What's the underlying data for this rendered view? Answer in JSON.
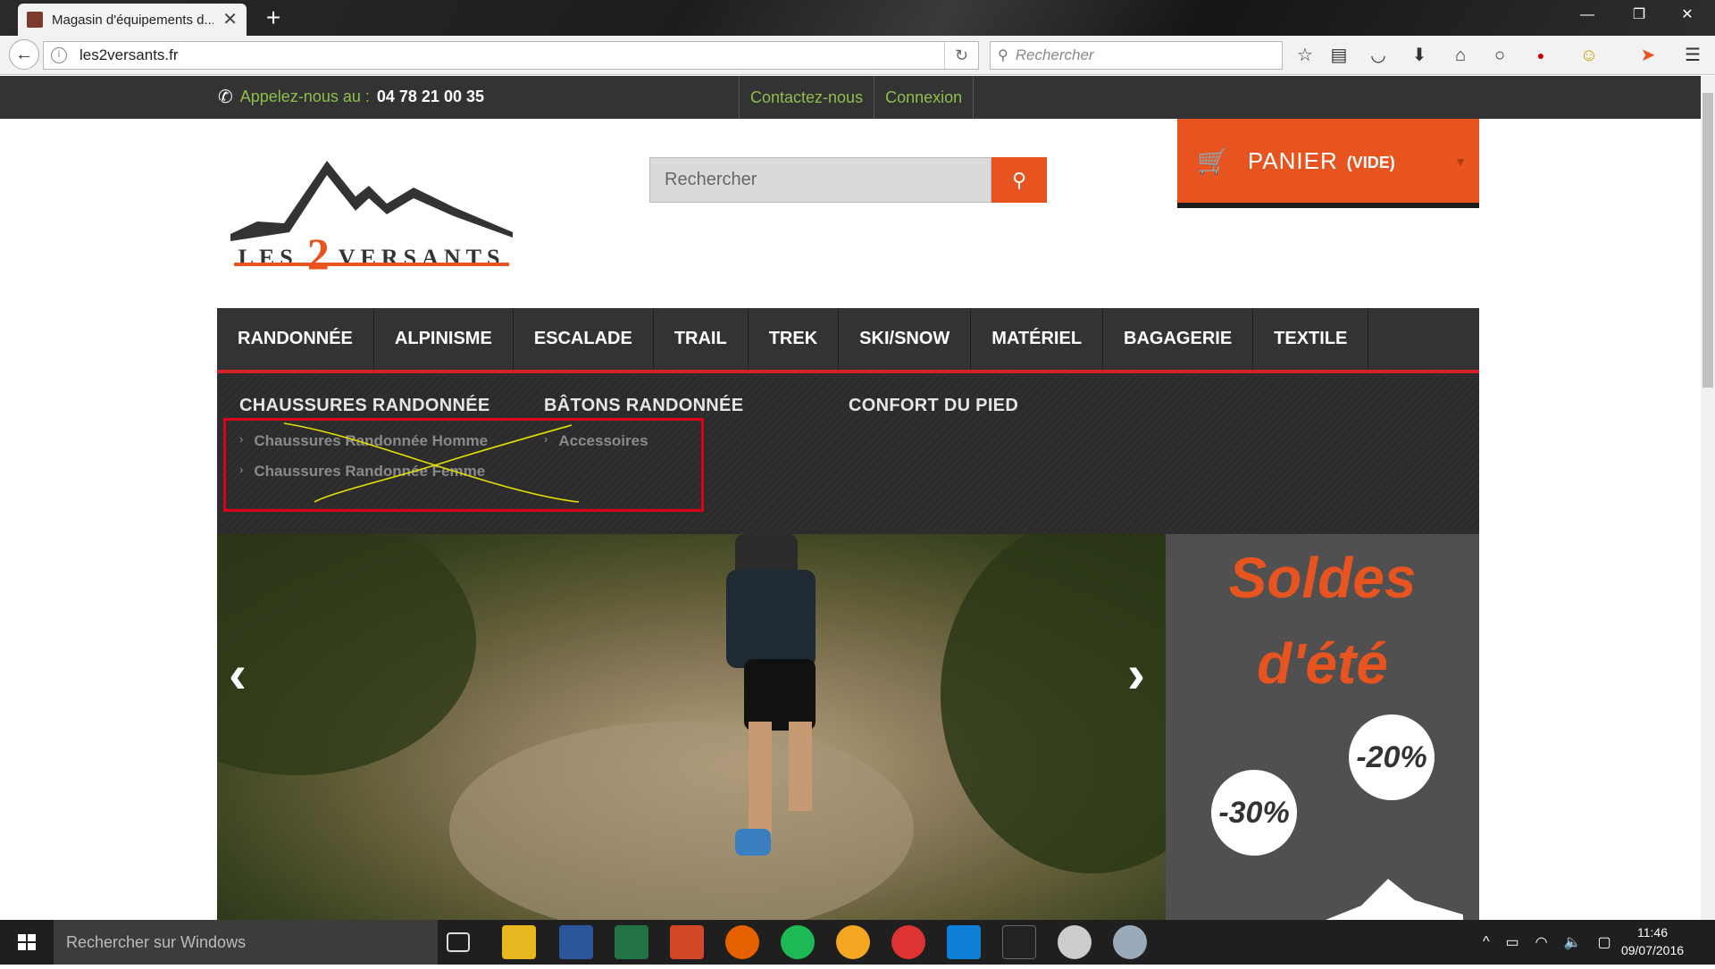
{
  "browser": {
    "tab_title": "Magasin d'équipements d...",
    "url": "les2versants.fr",
    "search_placeholder": "Rechercher"
  },
  "site": {
    "phone_label": "Appelez-nous au :",
    "phone_number": "04 78 21 00 35",
    "contact_link": "Contactez-nous",
    "login_link": "Connexion",
    "logo_text_left": "LES",
    "logo_number": "2",
    "logo_text_right": "VERSANTS",
    "search_placeholder": "Rechercher",
    "cart_label": "PANIER",
    "cart_status": "(VIDE)",
    "menu": [
      "RANDONNÉE",
      "ALPINISME",
      "ESCALADE",
      "TRAIL",
      "TREK",
      "SKI/SNOW",
      "MATÉRIEL",
      "BAGAGERIE",
      "TEXTILE"
    ],
    "dropdown": {
      "col1_title": "CHAUSSURES RANDONNÉE",
      "col1_items": [
        "Chaussures Randonnée Homme",
        "Chaussures Randonnée Femme"
      ],
      "col2_title": "BÂTONS RANDONNÉE",
      "col2_items": [
        "Accessoires"
      ],
      "col3_title": "CONFORT DU PIED"
    },
    "sale_line1": "Soldes",
    "sale_line2": "d'été",
    "badge1": "-20%",
    "badge2": "-30%"
  },
  "taskbar": {
    "search_placeholder": "Rechercher sur Windows",
    "time": "11:46",
    "date": "09/07/2016"
  },
  "colors": {
    "accent": "#e8541f",
    "menu_bg": "#333333",
    "highlight_red": "#d2232a",
    "link_green": "#8fbf4b"
  }
}
